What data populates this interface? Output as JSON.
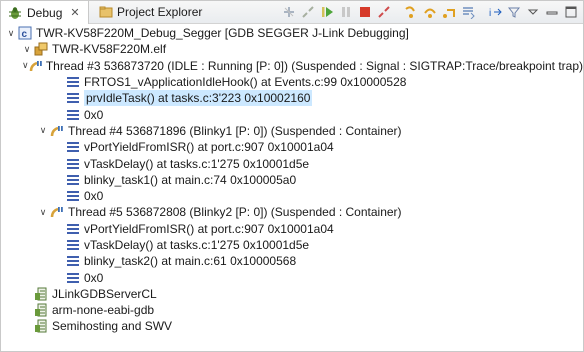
{
  "tabs": {
    "debug": "Debug",
    "project_explorer": "Project Explorer"
  },
  "toolbar_icons": [
    "remove-terminated-icon",
    "connect-icon",
    "resume-icon",
    "suspend-icon",
    "terminate-icon",
    "disconnect-icon",
    "step-into-icon",
    "step-over-icon",
    "step-return-icon",
    "drop-to-frame-icon",
    "instruction-stepping-icon",
    "debug-filters-icon",
    "view-menu-icon",
    "minimize-icon",
    "maximize-icon"
  ],
  "tree": {
    "launch": "TWR-KV58F220M_Debug_Segger [GDB SEGGER J-Link Debugging]",
    "elf": "TWR-KV58F220M.elf",
    "thread3": {
      "label": "Thread #3 536873720 (IDLE : Running [P: 0]) (Suspended : Signal : SIGTRAP:Trace/breakpoint trap)",
      "frames": [
        "FRTOS1_vApplicationIdleHook() at Events.c:99 0x10000528",
        "prvIdleTask() at tasks.c:3'223 0x10002160",
        "0x0"
      ]
    },
    "thread4": {
      "label": "Thread #4 536871896 (Blinky1 [P: 0]) (Suspended : Container)",
      "frames": [
        "vPortYieldFromISR() at port.c:907 0x10001a04",
        "vTaskDelay() at tasks.c:1'275 0x10001d5e",
        "blinky_task1() at main.c:74 0x100005a0",
        "0x0"
      ]
    },
    "thread5": {
      "label": "Thread #5 536872808 (Blinky2 [P: 0]) (Suspended : Container)",
      "frames": [
        "vPortYieldFromISR() at port.c:907 0x10001a04",
        "vTaskDelay() at tasks.c:1'275 0x10001d5e",
        "blinky_task2() at main.c:61 0x10000568",
        "0x0"
      ]
    },
    "processes": [
      "JLinkGDBServerCL",
      "arm-none-eabi-gdb",
      "Semihosting and SWV"
    ]
  },
  "colors": {
    "selection": "#cce8ff",
    "frame_icon": "#3f5fae",
    "thread_icon": "#d8a33a"
  }
}
